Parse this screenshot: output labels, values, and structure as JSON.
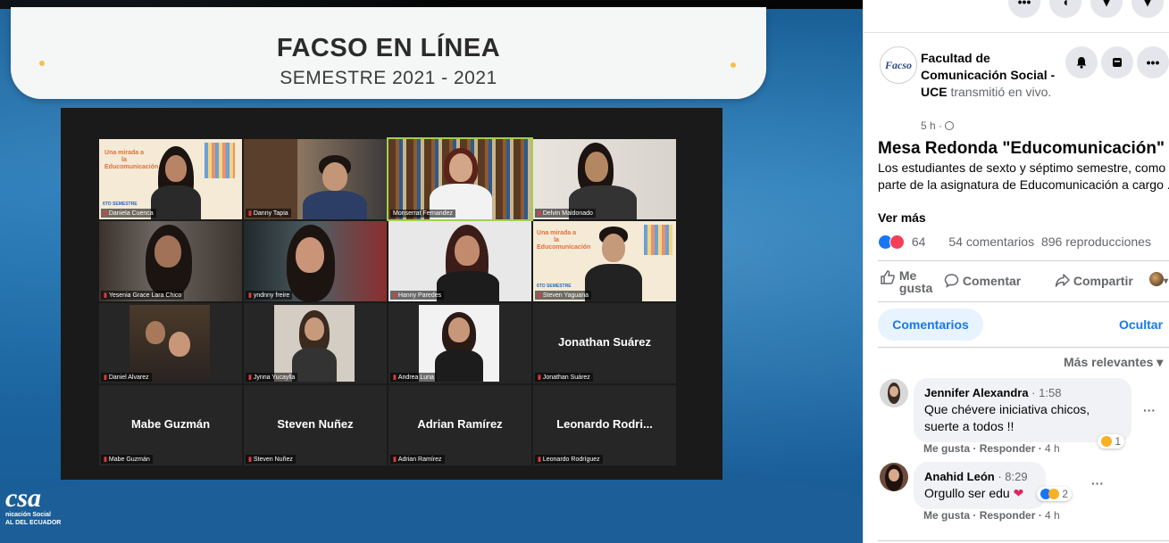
{
  "video": {
    "banner_title": "FACSO EN LÍNEA",
    "banner_subtitle": "SEMESTRE  2021 - 2021",
    "participants": [
      {
        "name": "Daniela Cuenca",
        "video": true
      },
      {
        "name": "Danny Tapia",
        "video": true
      },
      {
        "name": "Monserrat Fernandez",
        "video": true,
        "active": true
      },
      {
        "name": "Delvin Maldonado",
        "video": true
      },
      {
        "name": "Yesenia Grace Lara Chico",
        "video": true
      },
      {
        "name": "yndnny freire",
        "video": true
      },
      {
        "name": "Hanny Paredes",
        "video": true
      },
      {
        "name": "Steven Yaguana",
        "video": true
      },
      {
        "name": "Daniel Alvarez",
        "video": true
      },
      {
        "name": "Jynna Yucaylla",
        "video": true
      },
      {
        "name": "Andrea Luna",
        "video": true
      },
      {
        "name": "Jonathan Suárez",
        "video": false,
        "display_name": "Jonathan Suárez"
      },
      {
        "name": "Mabe Guzmán",
        "video": false,
        "display_name": "Mabe Guzmán"
      },
      {
        "name": "Steven Nuñez",
        "video": false,
        "display_name": "Steven Nuñez"
      },
      {
        "name": "Adrian Ramírez",
        "video": false,
        "display_name": "Adrian Ramírez"
      },
      {
        "name": "Leonardo Rodríguez",
        "video": false,
        "display_name": "Leonardo  Rodri..."
      }
    ],
    "promo_text": "Una mirada a la Educomunicación",
    "promo_badge": "6TO SEMESTRE",
    "logo_big": "csa",
    "logo_line1": "nicación Social",
    "logo_line2": "AL DEL ECUADOR"
  },
  "panel": {
    "top_icons": [
      "more-icon",
      "messenger-icon",
      "notification-icon",
      "chevron-icon"
    ],
    "page_avatar_text": "Facso",
    "page_name": "Facultad de Comunicación Social - UCE",
    "action_text": " transmitió en vivo.",
    "post_time": "5 h · ",
    "header_buttons": [
      "bell-icon",
      "save-icon",
      "more-icon"
    ],
    "post_title": "Mesa Redonda \"Educomunicación\"",
    "post_description": "Los estudiantes de sexto y séptimo semestre, como parte de la asignatura de Educomunicación a cargo ...",
    "see_more": "Ver más",
    "reaction_count": "64",
    "comment_count": "54 comentarios",
    "views": "896 reproducciones",
    "like_label": "Me gusta",
    "like_line1": "Me",
    "like_line2": "gusta",
    "comment_label": "Comentar",
    "share_label": "Compartir",
    "tab_comments": "Comentarios",
    "hide_label": "Ocultar",
    "sort_label": "Más relevantes",
    "comments": [
      {
        "author": "Jennifer Alexandra",
        "time": "1:58",
        "text": "Que chévere iniciativa chicos, suerte a todos !!",
        "like": "Me gusta",
        "reply": "Responder",
        "age": "4 h",
        "reaction_count": "1"
      },
      {
        "author": "Anahid León",
        "time": "8:29",
        "text": "Orgullo ser edu",
        "like": "Me gusta",
        "reply": "Responder",
        "age": "4 h",
        "reaction_count": "2"
      }
    ],
    "colors": {
      "accent": "#1877f2",
      "love": "#f33e58",
      "muted": "#65676b"
    }
  }
}
